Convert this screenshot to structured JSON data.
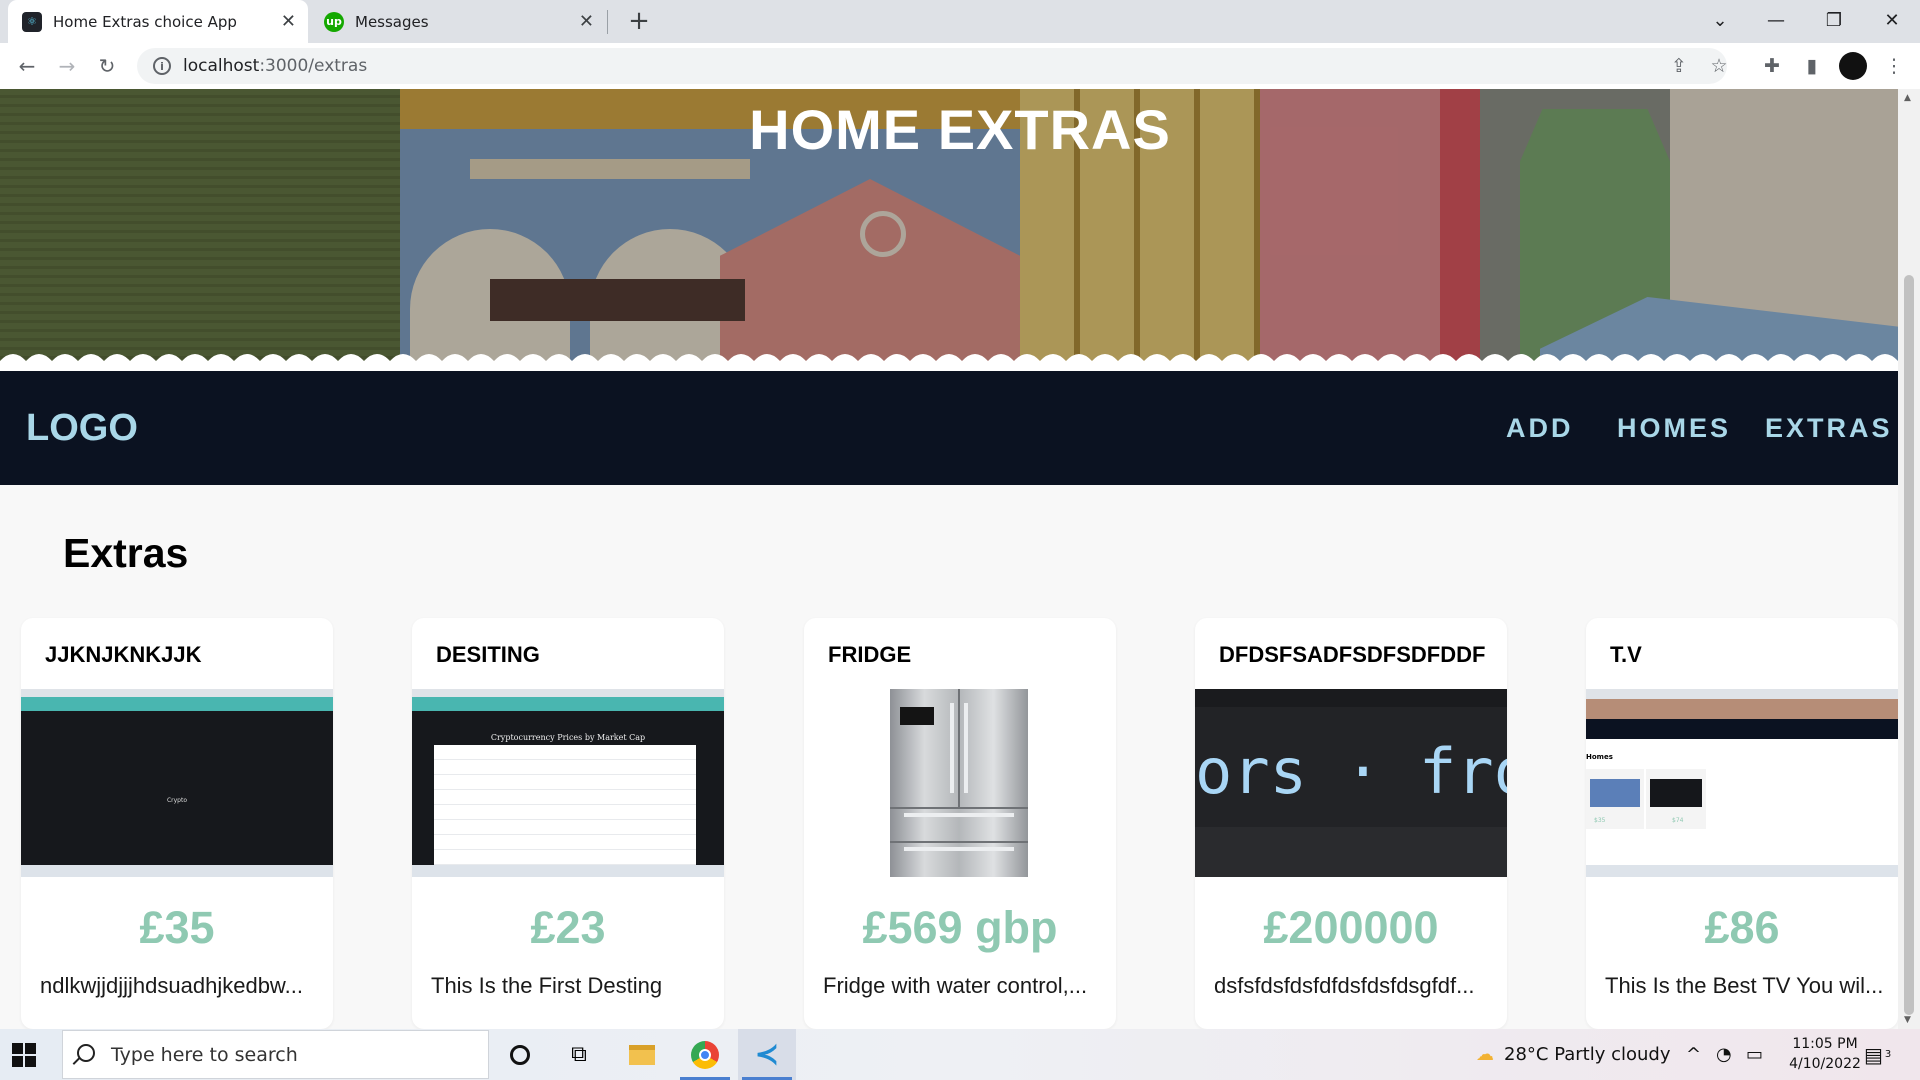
{
  "browser": {
    "tabs": [
      {
        "title": "Home Extras choice App",
        "active": true,
        "icon": "react-icon"
      },
      {
        "title": "Messages",
        "active": false,
        "icon": "upwork-icon"
      }
    ],
    "url_host": "localhost",
    "url_path": ":3000/extras"
  },
  "hero": {
    "title": "HOME EXTRAS"
  },
  "navbar": {
    "logo": "LOGO",
    "links": [
      "ADD",
      "HOMES",
      "EXTRAS"
    ]
  },
  "page": {
    "section_title": "Extras"
  },
  "cards": [
    {
      "title": "JJKNJKNKJJK",
      "price": "£35",
      "description": "ndlkwjjdjjjhdsuadhjkedbw...",
      "image": "screenshot-crypto-dark"
    },
    {
      "title": "DESITING",
      "price": "£23",
      "description": "This Is the First Desting",
      "image": "screenshot-crypto-prices"
    },
    {
      "title": "FRIDGE",
      "price": "£569 gbp",
      "description": "Fridge with water control,...",
      "image": "fridge-photo"
    },
    {
      "title": "DFDSFSADFSDFSDFDDF",
      "price": "£200000",
      "description": "dsfsfdsfdsfdfdsfdsfdsgfdf...",
      "image": "code-font-closeup"
    },
    {
      "title": "T.V",
      "price": "£86",
      "description": "This Is the Best TV You wil...",
      "image": "screenshot-homes-app"
    }
  ],
  "code_image_text": "ors · fron",
  "crypto_image": {
    "caption": "Crypto",
    "heading": "Cryptocurrency Prices by Market Cap"
  },
  "homes_image": {
    "heading": "Homes",
    "price_a": "$35",
    "price_b": "$74"
  },
  "taskbar": {
    "search_placeholder": "Type here to search",
    "weather": "28°C  Partly cloudy",
    "time": "11:05 PM",
    "date": "4/10/2022",
    "notifications": "3"
  },
  "colors": {
    "accent_price": "#8fc9b2",
    "nav_bg": "#0b1221",
    "nav_text": "#a9d7e8"
  }
}
